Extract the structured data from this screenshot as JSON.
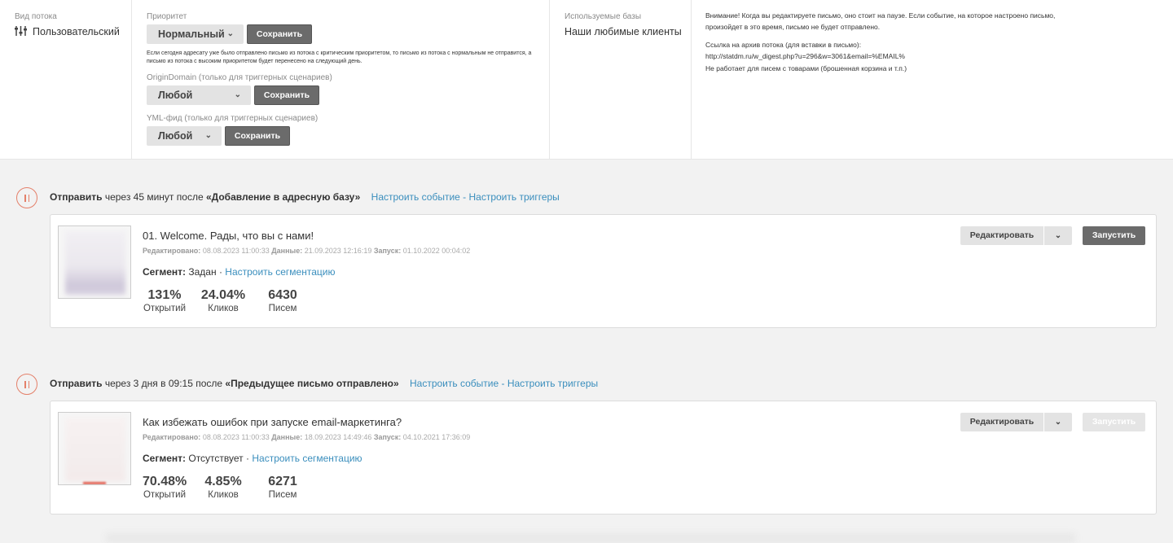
{
  "settings": {
    "flow_type": {
      "label": "Вид потока",
      "value": "Пользовательский",
      "icon": "sliders-icon"
    },
    "priority": {
      "label": "Приоритет",
      "selected": "Нормальный",
      "save": "Сохранить",
      "note": "Если сегодня адресату уже было отправлено письмо из потока с критическим приоритетом, то письмо из потока с нормальным не отправится, а письмо из потока с высоким приоритетом будет перенесено на следующий день."
    },
    "origin_domain": {
      "label": "OriginDomain (только для триггерных сценариев)",
      "selected": "Любой",
      "save": "Сохранить"
    },
    "yml_feed": {
      "label": "YML-фид (только для триггерных сценариев)",
      "selected": "Любой",
      "save": "Сохранить"
    },
    "bases": {
      "label": "Используемые базы",
      "value": "Наши любимые клиенты"
    },
    "info": {
      "warning": "Внимание! Когда вы редактируете письмо, оно стоит на паузе. Если событие, на которое настроено письмо, произойдет в это время, письмо не будет отправлено.",
      "archive_label": "Ссылка на архив потока (для вставки в письмо):",
      "archive_url": "http://statdm.ru/w_digest.php?u=296&w=3061&email=%EMAIL%",
      "archive_note": "Не работает для писем с товарами (брошенная корзина и т.п.)"
    }
  },
  "flows": [
    {
      "send": "Отправить",
      "when": "через 45 минут после",
      "event": "«Добавление в адресную базу»",
      "links": "Настроить событие - Настроить триггеры",
      "title": "01. Welcome. Рады, что вы с нами!",
      "edited_label": "Редактировано:",
      "edited": "08.08.2023 11:00:33",
      "data_label": "Данные:",
      "data": "21.09.2023 12:16:19",
      "launch_label": "Запуск:",
      "launch": "01.10.2022 00:04:02",
      "segment_label": "Сегмент:",
      "segment": "Задан",
      "segment_sep": "·",
      "segment_link": "Настроить сегментацию",
      "stats": [
        {
          "value": "131%",
          "label": "Открытий"
        },
        {
          "value": "24.04%",
          "label": "Кликов"
        },
        {
          "value": "6430",
          "label": "Писем"
        }
      ],
      "edit": "Редактировать",
      "run": "Запустить",
      "run_disabled": false
    },
    {
      "send": "Отправить",
      "when": "через 3 дня в 09:15 после",
      "event": "«Предыдущее письмо отправлено»",
      "links": "Настроить событие - Настроить триггеры",
      "title": "Как избежать ошибок при запуске email-маркетинга?",
      "edited_label": "Редактировано:",
      "edited": "08.08.2023 11:00:33",
      "data_label": "Данные:",
      "data": "18.09.2023 14:49:46",
      "launch_label": "Запуск:",
      "launch": "04.10.2021 17:36:09",
      "segment_label": "Сегмент:",
      "segment": "Отсутствует",
      "segment_sep": "·",
      "segment_link": "Настроить сегментацию",
      "stats": [
        {
          "value": "70.48%",
          "label": "Открытий"
        },
        {
          "value": "4.85%",
          "label": "Кликов"
        },
        {
          "value": "6271",
          "label": "Писем"
        }
      ],
      "edit": "Редактировать",
      "run": "Запустить",
      "run_disabled": true
    }
  ],
  "colors": {
    "accent_link": "#3a8ebd",
    "pause": "#e4806a",
    "button_dark": "#6b6b6b"
  }
}
